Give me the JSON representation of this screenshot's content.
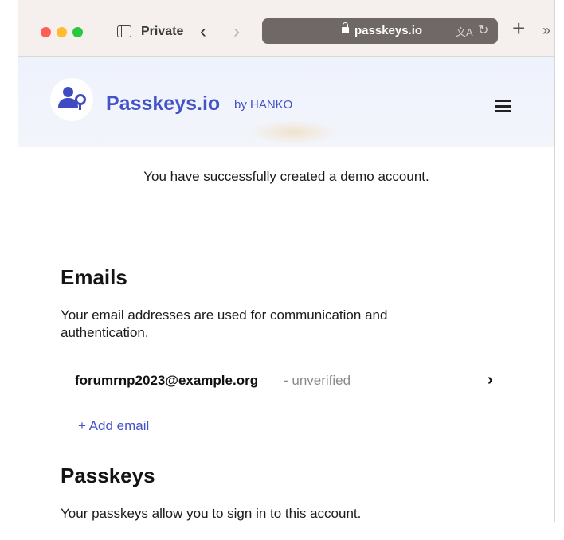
{
  "browser": {
    "private_label": "Private",
    "url": "passkeys.io",
    "icons": [
      "sidebar-icon",
      "back-icon",
      "forward-icon",
      "lock-icon",
      "translate-icon",
      "reload-icon",
      "plus-icon",
      "more-icon"
    ]
  },
  "site": {
    "logo_text": "Passkeys.io",
    "logo_by": "by HANKO",
    "brand_color": "#4452c8"
  },
  "success_message": "You have successfully created a demo account.",
  "emails": {
    "heading": "Emails",
    "description": "Your email addresses are used for communication and authentication.",
    "items": [
      {
        "address": "forumrnp2023@example.org",
        "status": " - unverified"
      }
    ],
    "add_label": "+ Add email"
  },
  "passkeys": {
    "heading": "Passkeys",
    "description": "Your passkeys allow you to sign in to this account."
  }
}
